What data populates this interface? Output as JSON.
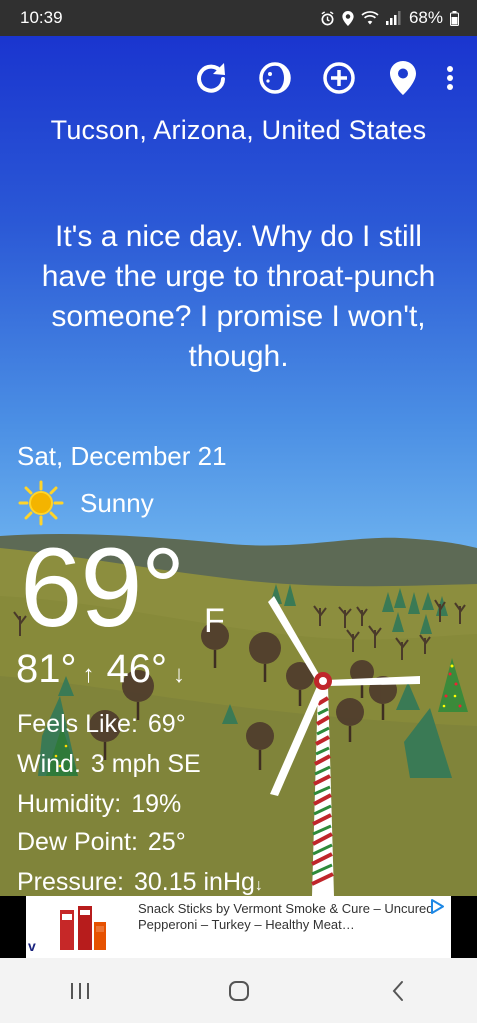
{
  "status": {
    "time": "10:39",
    "battery": "68%",
    "icons": [
      "alarm-icon",
      "location-icon",
      "wifi-icon",
      "signal-icon",
      "battery-icon"
    ]
  },
  "toolbar": {
    "icons": [
      "refresh-icon",
      "moon-phase-icon",
      "add-location-icon",
      "location-pin-icon",
      "more-vert-icon"
    ]
  },
  "weather": {
    "location": "Tucson, Arizona, United States",
    "quip": "It's a nice day. Why do I still have the urge to throat-punch someone? I promise I won't, though.",
    "date": "Sat, December 21",
    "condition": "Sunny",
    "condition_icon": "sun-icon",
    "temperature": "69°",
    "unit": "F",
    "high": "81°",
    "low": "46°",
    "details": {
      "feels_like_label": "Feels Like:",
      "feels_like": "69°",
      "wind_label": "Wind:",
      "wind": "3 mph SE",
      "humidity_label": "Humidity:",
      "humidity": "19%",
      "dew_point_label": "Dew Point:",
      "dew_point": "25°",
      "pressure_label": "Pressure:",
      "pressure": "30.15 inHg"
    }
  },
  "ad": {
    "text": "Snack Sticks by Vermont Smoke & Cure – Uncured Pepperoni – Turkey – Healthy Meat…"
  },
  "nav": {
    "icons": [
      "recent-apps-icon",
      "home-icon",
      "back-icon"
    ]
  },
  "colors": {
    "sky_top": "#1a35cf",
    "sky_bottom": "#8ccaf7",
    "hills": "#8a8c3a",
    "far_hills": "#5c6a4a"
  }
}
